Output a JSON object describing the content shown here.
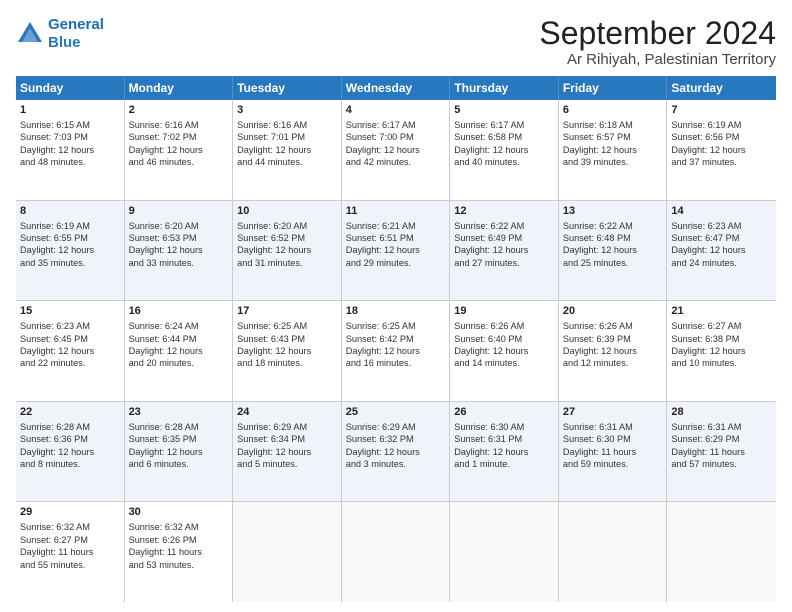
{
  "logo": {
    "line1": "General",
    "line2": "Blue"
  },
  "title": "September 2024",
  "location": "Ar Rihiyah, Palestinian Territory",
  "days_of_week": [
    "Sunday",
    "Monday",
    "Tuesday",
    "Wednesday",
    "Thursday",
    "Friday",
    "Saturday"
  ],
  "weeks": [
    [
      {
        "day": 1,
        "lines": [
          "Sunrise: 6:15 AM",
          "Sunset: 7:03 PM",
          "Daylight: 12 hours",
          "and 48 minutes."
        ]
      },
      {
        "day": 2,
        "lines": [
          "Sunrise: 6:16 AM",
          "Sunset: 7:02 PM",
          "Daylight: 12 hours",
          "and 46 minutes."
        ]
      },
      {
        "day": 3,
        "lines": [
          "Sunrise: 6:16 AM",
          "Sunset: 7:01 PM",
          "Daylight: 12 hours",
          "and 44 minutes."
        ]
      },
      {
        "day": 4,
        "lines": [
          "Sunrise: 6:17 AM",
          "Sunset: 7:00 PM",
          "Daylight: 12 hours",
          "and 42 minutes."
        ]
      },
      {
        "day": 5,
        "lines": [
          "Sunrise: 6:17 AM",
          "Sunset: 6:58 PM",
          "Daylight: 12 hours",
          "and 40 minutes."
        ]
      },
      {
        "day": 6,
        "lines": [
          "Sunrise: 6:18 AM",
          "Sunset: 6:57 PM",
          "Daylight: 12 hours",
          "and 39 minutes."
        ]
      },
      {
        "day": 7,
        "lines": [
          "Sunrise: 6:19 AM",
          "Sunset: 6:56 PM",
          "Daylight: 12 hours",
          "and 37 minutes."
        ]
      }
    ],
    [
      {
        "day": 8,
        "lines": [
          "Sunrise: 6:19 AM",
          "Sunset: 6:55 PM",
          "Daylight: 12 hours",
          "and 35 minutes."
        ]
      },
      {
        "day": 9,
        "lines": [
          "Sunrise: 6:20 AM",
          "Sunset: 6:53 PM",
          "Daylight: 12 hours",
          "and 33 minutes."
        ]
      },
      {
        "day": 10,
        "lines": [
          "Sunrise: 6:20 AM",
          "Sunset: 6:52 PM",
          "Daylight: 12 hours",
          "and 31 minutes."
        ]
      },
      {
        "day": 11,
        "lines": [
          "Sunrise: 6:21 AM",
          "Sunset: 6:51 PM",
          "Daylight: 12 hours",
          "and 29 minutes."
        ]
      },
      {
        "day": 12,
        "lines": [
          "Sunrise: 6:22 AM",
          "Sunset: 6:49 PM",
          "Daylight: 12 hours",
          "and 27 minutes."
        ]
      },
      {
        "day": 13,
        "lines": [
          "Sunrise: 6:22 AM",
          "Sunset: 6:48 PM",
          "Daylight: 12 hours",
          "and 25 minutes."
        ]
      },
      {
        "day": 14,
        "lines": [
          "Sunrise: 6:23 AM",
          "Sunset: 6:47 PM",
          "Daylight: 12 hours",
          "and 24 minutes."
        ]
      }
    ],
    [
      {
        "day": 15,
        "lines": [
          "Sunrise: 6:23 AM",
          "Sunset: 6:45 PM",
          "Daylight: 12 hours",
          "and 22 minutes."
        ]
      },
      {
        "day": 16,
        "lines": [
          "Sunrise: 6:24 AM",
          "Sunset: 6:44 PM",
          "Daylight: 12 hours",
          "and 20 minutes."
        ]
      },
      {
        "day": 17,
        "lines": [
          "Sunrise: 6:25 AM",
          "Sunset: 6:43 PM",
          "Daylight: 12 hours",
          "and 18 minutes."
        ]
      },
      {
        "day": 18,
        "lines": [
          "Sunrise: 6:25 AM",
          "Sunset: 6:42 PM",
          "Daylight: 12 hours",
          "and 16 minutes."
        ]
      },
      {
        "day": 19,
        "lines": [
          "Sunrise: 6:26 AM",
          "Sunset: 6:40 PM",
          "Daylight: 12 hours",
          "and 14 minutes."
        ]
      },
      {
        "day": 20,
        "lines": [
          "Sunrise: 6:26 AM",
          "Sunset: 6:39 PM",
          "Daylight: 12 hours",
          "and 12 minutes."
        ]
      },
      {
        "day": 21,
        "lines": [
          "Sunrise: 6:27 AM",
          "Sunset: 6:38 PM",
          "Daylight: 12 hours",
          "and 10 minutes."
        ]
      }
    ],
    [
      {
        "day": 22,
        "lines": [
          "Sunrise: 6:28 AM",
          "Sunset: 6:36 PM",
          "Daylight: 12 hours",
          "and 8 minutes."
        ]
      },
      {
        "day": 23,
        "lines": [
          "Sunrise: 6:28 AM",
          "Sunset: 6:35 PM",
          "Daylight: 12 hours",
          "and 6 minutes."
        ]
      },
      {
        "day": 24,
        "lines": [
          "Sunrise: 6:29 AM",
          "Sunset: 6:34 PM",
          "Daylight: 12 hours",
          "and 5 minutes."
        ]
      },
      {
        "day": 25,
        "lines": [
          "Sunrise: 6:29 AM",
          "Sunset: 6:32 PM",
          "Daylight: 12 hours",
          "and 3 minutes."
        ]
      },
      {
        "day": 26,
        "lines": [
          "Sunrise: 6:30 AM",
          "Sunset: 6:31 PM",
          "Daylight: 12 hours",
          "and 1 minute."
        ]
      },
      {
        "day": 27,
        "lines": [
          "Sunrise: 6:31 AM",
          "Sunset: 6:30 PM",
          "Daylight: 11 hours",
          "and 59 minutes."
        ]
      },
      {
        "day": 28,
        "lines": [
          "Sunrise: 6:31 AM",
          "Sunset: 6:29 PM",
          "Daylight: 11 hours",
          "and 57 minutes."
        ]
      }
    ],
    [
      {
        "day": 29,
        "lines": [
          "Sunrise: 6:32 AM",
          "Sunset: 6:27 PM",
          "Daylight: 11 hours",
          "and 55 minutes."
        ]
      },
      {
        "day": 30,
        "lines": [
          "Sunrise: 6:32 AM",
          "Sunset: 6:26 PM",
          "Daylight: 11 hours",
          "and 53 minutes."
        ]
      },
      null,
      null,
      null,
      null,
      null
    ]
  ]
}
